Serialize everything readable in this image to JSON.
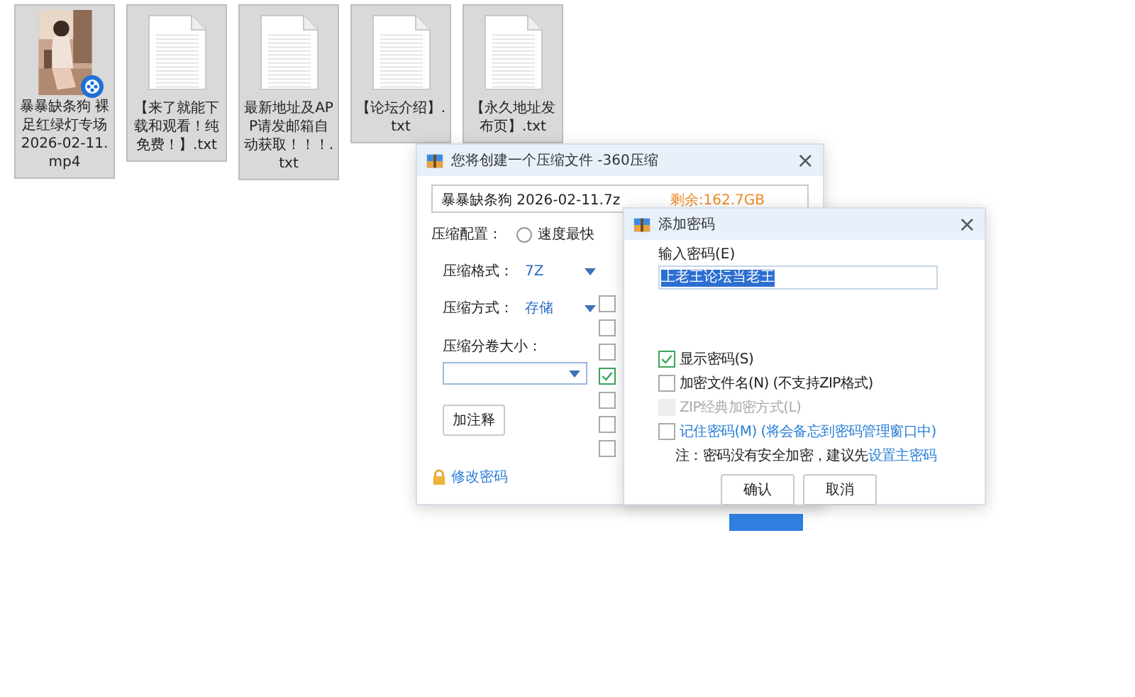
{
  "files": [
    {
      "kind": "video",
      "name": "暴暴缺条狗  裸足红绿灯专场2026-02-11.mp4",
      "selected": true
    },
    {
      "kind": "text",
      "name": "【来了就能下载和观看！纯免费！】.txt",
      "selected": true
    },
    {
      "kind": "text",
      "name": "最新地址及APP请发邮箱自动获取！！！.txt",
      "selected": true
    },
    {
      "kind": "text",
      "name": "【论坛介绍】.txt",
      "selected": true
    },
    {
      "kind": "text",
      "name": "【永久地址发布页】.txt",
      "selected": true
    }
  ],
  "compress_dialog": {
    "title": "您将创建一个压缩文件 -360压缩",
    "close": "×",
    "filename": "暴暴缺条狗   2026-02-11.7z",
    "free_space": "剩余:162.7GB",
    "config_label": "压缩配置：",
    "config_options": [
      {
        "label": "速度最快",
        "selected": false
      }
    ],
    "format_label": "压缩格式：",
    "format_value": "7Z",
    "method_label": "压缩方式：",
    "method_value": "存储",
    "split_label": "压缩分卷大小：",
    "comment_button": "加注释",
    "change_password": "修改密码",
    "options": [
      {
        "checked": false
      },
      {
        "checked": false
      },
      {
        "checked": false
      },
      {
        "checked": true
      },
      {
        "checked": false
      },
      {
        "checked": false
      },
      {
        "checked": false
      }
    ]
  },
  "password_dialog": {
    "title": "添加密码",
    "close": "×",
    "password_label": "输入密码(E)",
    "password_value": "上老王论坛当老王",
    "checks": [
      {
        "label": "显示密码(S)",
        "checked": true,
        "disabled": false,
        "kind": "plain"
      },
      {
        "label": "加密文件名(N) (不支持ZIP格式)",
        "checked": false,
        "disabled": false,
        "kind": "plain"
      },
      {
        "label": "ZIP经典加密方式(L)",
        "checked": false,
        "disabled": true,
        "kind": "plain"
      },
      {
        "label": "记住密码(M) (将会备忘到密码管理窗口中)",
        "checked": false,
        "disabled": false,
        "kind": "link"
      }
    ],
    "note": "注：密码没有安全加密，建议先",
    "note_link": "设置主密码",
    "ok": "确认",
    "cancel": "取消"
  }
}
